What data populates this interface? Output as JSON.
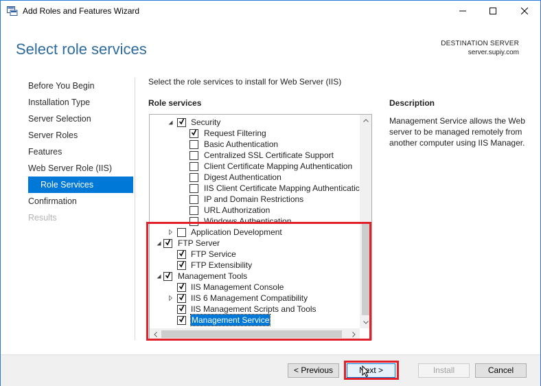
{
  "window": {
    "title": "Add Roles and Features Wizard",
    "controls": [
      "minimize-icon",
      "maximize-icon",
      "close-icon"
    ]
  },
  "header": {
    "title": "Select role services",
    "destination_label": "DESTINATION SERVER",
    "destination_value": "server.supiy.com"
  },
  "nav": {
    "items": [
      {
        "label": "Before You Begin",
        "state": "normal"
      },
      {
        "label": "Installation Type",
        "state": "normal"
      },
      {
        "label": "Server Selection",
        "state": "normal"
      },
      {
        "label": "Server Roles",
        "state": "normal"
      },
      {
        "label": "Features",
        "state": "normal"
      },
      {
        "label": "Web Server Role (IIS)",
        "state": "normal"
      },
      {
        "label": "Role Services",
        "state": "active"
      },
      {
        "label": "Confirmation",
        "state": "normal"
      },
      {
        "label": "Results",
        "state": "disabled"
      }
    ]
  },
  "main": {
    "instruction": "Select the role services to install for Web Server (IIS)",
    "role_services_heading": "Role services",
    "tree": [
      {
        "label": "Security",
        "level": 1,
        "checked": true,
        "expander": "expanded"
      },
      {
        "label": "Request Filtering",
        "level": 2,
        "checked": true,
        "expander": "none"
      },
      {
        "label": "Basic Authentication",
        "level": 2,
        "checked": false,
        "expander": "none"
      },
      {
        "label": "Centralized SSL Certificate Support",
        "level": 2,
        "checked": false,
        "expander": "none"
      },
      {
        "label": "Client Certificate Mapping Authentication",
        "level": 2,
        "checked": false,
        "expander": "none"
      },
      {
        "label": "Digest Authentication",
        "level": 2,
        "checked": false,
        "expander": "none"
      },
      {
        "label": "IIS Client Certificate Mapping Authenticatic",
        "level": 2,
        "checked": false,
        "expander": "none"
      },
      {
        "label": "IP and Domain Restrictions",
        "level": 2,
        "checked": false,
        "expander": "none"
      },
      {
        "label": "URL Authorization",
        "level": 2,
        "checked": false,
        "expander": "none"
      },
      {
        "label": "Windows Authentication",
        "level": 2,
        "checked": false,
        "expander": "none"
      },
      {
        "label": "Application Development",
        "level": 1,
        "checked": false,
        "expander": "collapsed"
      },
      {
        "label": "FTP Server",
        "level": 0,
        "checked": true,
        "expander": "expanded"
      },
      {
        "label": "FTP Service",
        "level": 1,
        "checked": true,
        "expander": "none"
      },
      {
        "label": "FTP Extensibility",
        "level": 1,
        "checked": true,
        "expander": "none"
      },
      {
        "label": "Management Tools",
        "level": 0,
        "checked": true,
        "expander": "expanded"
      },
      {
        "label": "IIS Management Console",
        "level": 1,
        "checked": true,
        "expander": "none"
      },
      {
        "label": "IIS 6 Management Compatibility",
        "level": 1,
        "checked": true,
        "expander": "collapsed"
      },
      {
        "label": "IIS Management Scripts and Tools",
        "level": 1,
        "checked": true,
        "expander": "none"
      },
      {
        "label": "Management Service",
        "level": 1,
        "checked": true,
        "expander": "none",
        "selected": true
      }
    ]
  },
  "description": {
    "heading": "Description",
    "text": "Management Service allows the Web server to be managed remotely from another computer using IIS Manager."
  },
  "footer": {
    "previous_label": "< Previous",
    "next_label": "Next >",
    "install_label": "Install",
    "cancel_label": "Cancel"
  },
  "colors": {
    "accent": "#0078d7",
    "title_blue": "#2d6a9e",
    "highlight_red": "#e0202b"
  }
}
